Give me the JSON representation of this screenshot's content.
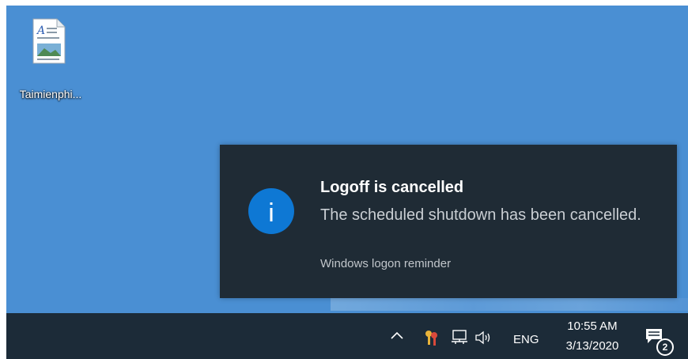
{
  "desktop": {
    "icon_name": "document-icon",
    "icon_label": "Taimienphi..."
  },
  "toast": {
    "icon": "info-icon",
    "title": "Logoff is cancelled",
    "body": "The scheduled shutdown has been cancelled.",
    "source": "Windows logon reminder"
  },
  "taskbar": {
    "tray_icons": [
      "chevron-up-icon",
      "keys-icon",
      "network-icon",
      "volume-icon"
    ],
    "language": "ENG",
    "time": "10:55 AM",
    "date": "3/13/2020",
    "notification_count": "2"
  },
  "colors": {
    "desktop_bg": "#4a8fd3",
    "toast_bg": "#1f2b35",
    "info_blue": "#0e78d4",
    "taskbar_bg": "#1c2b38"
  }
}
